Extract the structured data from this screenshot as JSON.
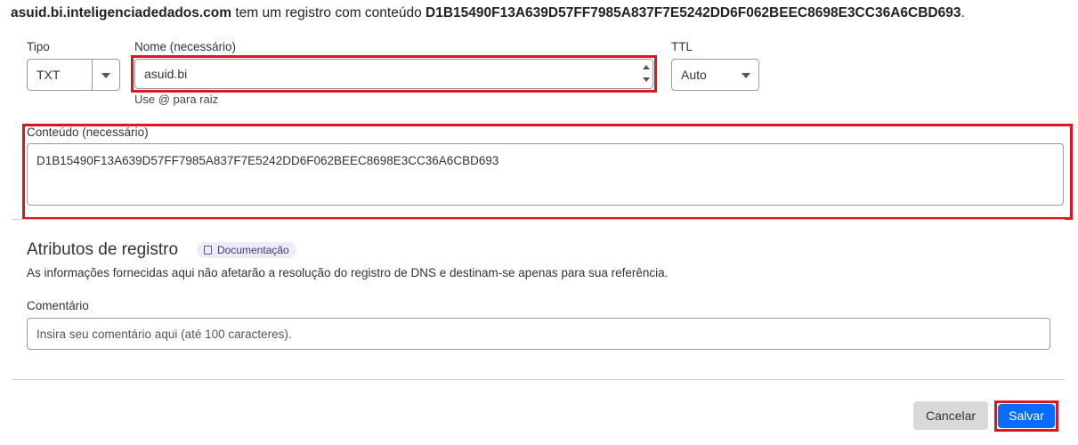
{
  "summary": {
    "domain": "asuid.bi.inteligenciadedados.com",
    "middle": " tem um registro com conteúdo ",
    "content": "D1B15490F13A639D57FF7985A837F7E5242DD6F062BEEC8698E3CC36A6CBD693",
    "end": "."
  },
  "tipo": {
    "label": "Tipo",
    "value": "TXT"
  },
  "nome": {
    "label": "Nome (necessário)",
    "value": "asuid.bi",
    "hint": "Use @ para raiz"
  },
  "ttl": {
    "label": "TTL",
    "value": "Auto"
  },
  "conteudo": {
    "label": "Conteúdo (necessário)",
    "value": "D1B15490F13A639D57FF7985A837F7E5242DD6F062BEEC8698E3CC36A6CBD693"
  },
  "atributos": {
    "title": "Atributos de registro",
    "doc_label": "Documentação",
    "description": "As informações fornecidas aqui não afetarão a resolução do registro de DNS e destinam-se apenas para sua referência."
  },
  "comentario": {
    "label": "Comentário",
    "placeholder": "Insira seu comentário aqui (até 100 caracteres)."
  },
  "actions": {
    "cancel_label": "Cancelar",
    "save_label": "Salvar"
  },
  "colors": {
    "highlight": "#e0141e",
    "primary": "#0a6cff",
    "cancel_bg": "#d9d9d9"
  }
}
